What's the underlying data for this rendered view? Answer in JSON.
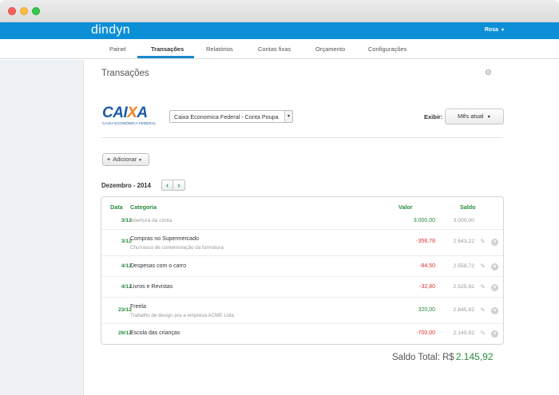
{
  "app": {
    "logo": "dindyn",
    "user": "Rosa",
    "user_caret": "▾"
  },
  "nav": {
    "items": [
      "Painel",
      "Transações",
      "Relatórios",
      "Contas fixas",
      "Orçamento",
      "Configurações"
    ],
    "active": "Transações"
  },
  "page": {
    "title": "Transações",
    "gear_icon": "⚙"
  },
  "account": {
    "logo_word_a": "CAI",
    "logo_word_x": "X",
    "logo_word_b": "A",
    "logo_sub": "CAIXA ECONÔMICA FEDERAL",
    "selected": "Caixa Economica Federal - Conta Poupa",
    "select_arrow": "▾"
  },
  "view": {
    "label": "Exibir:",
    "selected": "Mês atual",
    "caret": "▼"
  },
  "add_button": {
    "plus": "+",
    "label": "Adicionar",
    "caret": "▼"
  },
  "period": {
    "label": "Dezembro - 2014",
    "prev": "‹",
    "next": "›"
  },
  "table": {
    "headers": {
      "date": "Data",
      "category": "Categoria",
      "value": "Valor",
      "balance": "Saldo"
    },
    "rows": [
      {
        "date": "3/12",
        "category": "Abertura da conta",
        "note": "",
        "value": "3.000,00",
        "balance": "3.000,00"
      },
      {
        "date": "3/12",
        "category": "Compras no Supermercado",
        "note": "Churrasco de comemoração da formatura",
        "value": "-356,78",
        "balance": "2.643,22"
      },
      {
        "date": "4/12",
        "category": "Despesas com o carro",
        "note": "",
        "value": "-84,50",
        "balance": "2.558,72"
      },
      {
        "date": "4/12",
        "category": "Livros e Revistas",
        "note": "",
        "value": "-32,80",
        "balance": "2.525,92"
      },
      {
        "date": "23/12",
        "category": "Freela",
        "note": "Trabalho de design pra a empresa ACME Ltda.",
        "value": "320,00",
        "balance": "2.845,92"
      },
      {
        "date": "26/12",
        "category": "Escola das crianças",
        "note": "",
        "value": "-700,00",
        "balance": "2.145,92"
      }
    ],
    "edit_icon": "✎",
    "delete_icon": "×"
  },
  "total": {
    "label": "Saldo Total:",
    "currency": "R$",
    "amount": "2.145,92"
  },
  "colors": {
    "brand": "#0c8fd6",
    "positive": "#2d8c3c",
    "negative": "#e03131",
    "caixa_blue": "#1c5ca8",
    "caixa_orange": "#f58220"
  }
}
